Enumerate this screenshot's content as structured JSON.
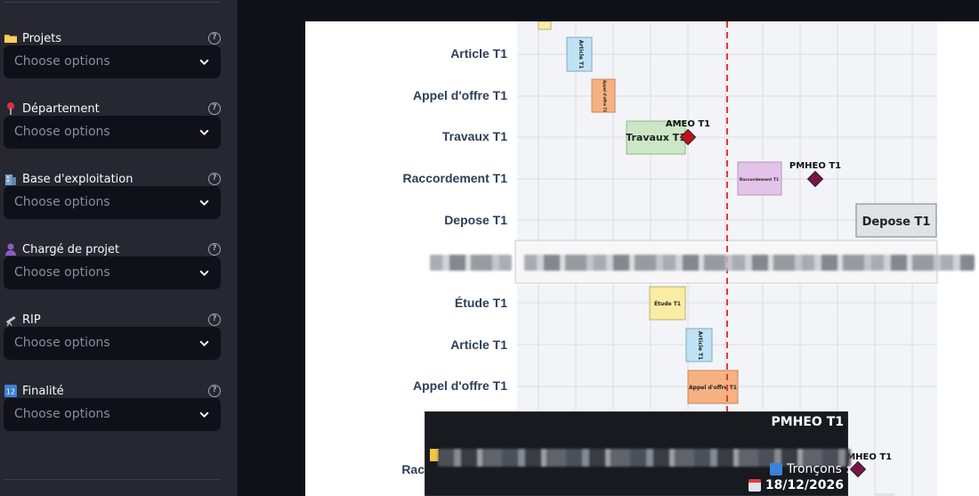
{
  "sidebar": {
    "filters": [
      {
        "label": "Projets",
        "icon": "folder-icon",
        "placeholder": "Choose options"
      },
      {
        "label": "Département",
        "icon": "pin-icon",
        "placeholder": "Choose options"
      },
      {
        "label": "Base d'exploitation",
        "icon": "building-icon",
        "placeholder": "Choose options"
      },
      {
        "label": "Chargé de projet",
        "icon": "person-icon",
        "placeholder": "Choose options"
      },
      {
        "label": "RIP",
        "icon": "telescope-icon",
        "placeholder": "Choose options"
      },
      {
        "label": "Finalité",
        "icon": "numbers-icon",
        "placeholder": "Choose options"
      }
    ]
  },
  "chart": {
    "top_group": {
      "rows": [
        "Article T1",
        "Appel d'offre T1",
        "Travaux T1",
        "Raccordement T1",
        "Depose T1"
      ],
      "bars": [
        {
          "label": "Article T1",
          "color": "#bfe3f5"
        },
        {
          "label": "Appel d'offre T1",
          "color": "#f6b183"
        },
        {
          "label": "Travaux T1",
          "color": "#cbe7c6"
        },
        {
          "label": "Raccordement T1",
          "color": "#e3c3ea"
        },
        {
          "label": "Depose T1",
          "color": "#dfe3e6"
        }
      ],
      "milestones": [
        {
          "label": "AMEO T1",
          "color": "#c0121b"
        },
        {
          "label": "PMHEO T1",
          "color": "#7a1348"
        }
      ]
    },
    "bottom_group": {
      "rows": [
        "Étude T1",
        "Article T1",
        "Appel d'offre T1"
      ],
      "partial_row": "Rac",
      "bars": [
        {
          "label": "Étude T1",
          "color": "#f8eda3"
        },
        {
          "label": "Article T1",
          "color": "#bfe3f5"
        },
        {
          "label": "Appel d'offre T1",
          "color": "#f6b183"
        }
      ],
      "milestones": [
        {
          "label": "PMHEO T1",
          "color": "#7a1348"
        }
      ]
    },
    "today_line_color": "#e03a3a"
  },
  "tooltip": {
    "title": "PMHEO T1",
    "troncons_label": "Tronçons :",
    "date": "18/12/2026"
  }
}
